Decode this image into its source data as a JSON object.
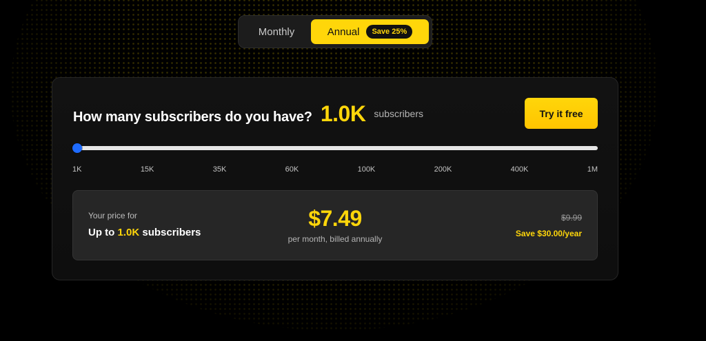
{
  "billing_toggle": {
    "monthly_label": "Monthly",
    "annual_label": "Annual",
    "annual_badge": "Save 25%",
    "selected": "Annual"
  },
  "pricing_card": {
    "question": "How many subscribers do you have?",
    "subscriber_count": "1.0K",
    "subscriber_unit": "subscribers",
    "cta_label": "Try it free"
  },
  "slider": {
    "value_fraction": 0,
    "tick_labels": [
      "1K",
      "15K",
      "35K",
      "60K",
      "100K",
      "200K",
      "400K",
      "1M"
    ]
  },
  "price_summary": {
    "label": "Your price for",
    "upto_prefix": "Up to",
    "upto_value": "1.0K",
    "upto_suffix": "subscribers",
    "price": "$7.49",
    "billing_note": "per month, billed annually",
    "original_price": "$9.99",
    "savings": "Save $30.00/year"
  },
  "colors": {
    "accent": "#ffd60a",
    "slider_thumb": "#1e6bff",
    "background": "#000000",
    "card": "#121212",
    "price_box": "#262626"
  }
}
